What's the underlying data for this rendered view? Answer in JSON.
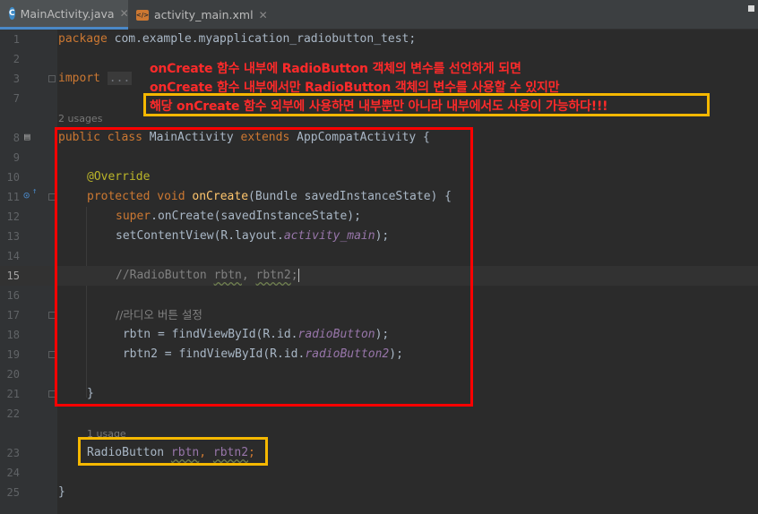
{
  "tabs": [
    {
      "label": "MainActivity.java",
      "icon": "java-class-icon",
      "active": true
    },
    {
      "label": "activity_main.xml",
      "icon": "xml-file-icon",
      "active": false
    }
  ],
  "usages": {
    "class": "2 usages",
    "field": "1 usage"
  },
  "annotation_lines": [
    "onCreate 함수 내부에 RadioButton 객체의 변수를 선언하게 되면",
    "onCreate 함수 내부에서만 RadioButton 객체의 변수를 사용할 수 있지만",
    "해당 onCreate 함수 외부에 사용하면 내부뿐만 아니라 내부에서도 사용이 가능하다!!!"
  ],
  "code": {
    "l1": {
      "num": "1",
      "package_kw": "package",
      "package_name": " com.example.myapplication_radiobutton_test;"
    },
    "l2": {
      "num": "2"
    },
    "l3": {
      "num": "3",
      "import_kw": "import",
      "folded": "..."
    },
    "l7": {
      "num": "7"
    },
    "l8": {
      "num": "8",
      "kw": "public class",
      "name": " MainActivity ",
      "extends": "extends",
      "rest": " AppCompatActivity {"
    },
    "l9": {
      "num": "9"
    },
    "l10": {
      "num": "10",
      "annotation": "@Override"
    },
    "l11": {
      "num": "11",
      "kw": "protected void",
      "fn": "onCreate",
      "rest": "(Bundle savedInstanceState) {"
    },
    "l12": {
      "num": "12",
      "kw": "super",
      "rest": ".onCreate(savedInstanceState);"
    },
    "l13": {
      "num": "13",
      "pre": "setContentView(R.layout.",
      "it": "activity_main",
      "post": ");"
    },
    "l14": {
      "num": "14"
    },
    "l15": {
      "num": "15",
      "comment_a": "//RadioButton ",
      "comment_b": "rbtn",
      "comment_c": ", ",
      "comment_d": "rbtn2",
      "comment_e": ";"
    },
    "l16": {
      "num": "16"
    },
    "l17": {
      "num": "17",
      "comment": "//라디오 버튼 설정"
    },
    "l18": {
      "num": "18",
      "pre": " rbtn = findViewById(R.id.",
      "it": "radioButton",
      "post": ");"
    },
    "l19": {
      "num": "19",
      "pre": " rbtn2 = findViewById(R.id.",
      "it": "radioButton2",
      "post": ");"
    },
    "l20": {
      "num": "20"
    },
    "l21": {
      "num": "21",
      "text": "}"
    },
    "l22": {
      "num": "22"
    },
    "l23": {
      "num": "23",
      "type": "RadioButton ",
      "v1": "rbtn",
      "sep": ", ",
      "v2": "rbtn2",
      "end": ";"
    },
    "l24": {
      "num": "24"
    },
    "l25": {
      "num": "25",
      "text": "}"
    }
  },
  "colors": {
    "red_box": "#ff0000",
    "yellow_box": "#f5b800",
    "annotation_text": "#ff2a2a"
  }
}
